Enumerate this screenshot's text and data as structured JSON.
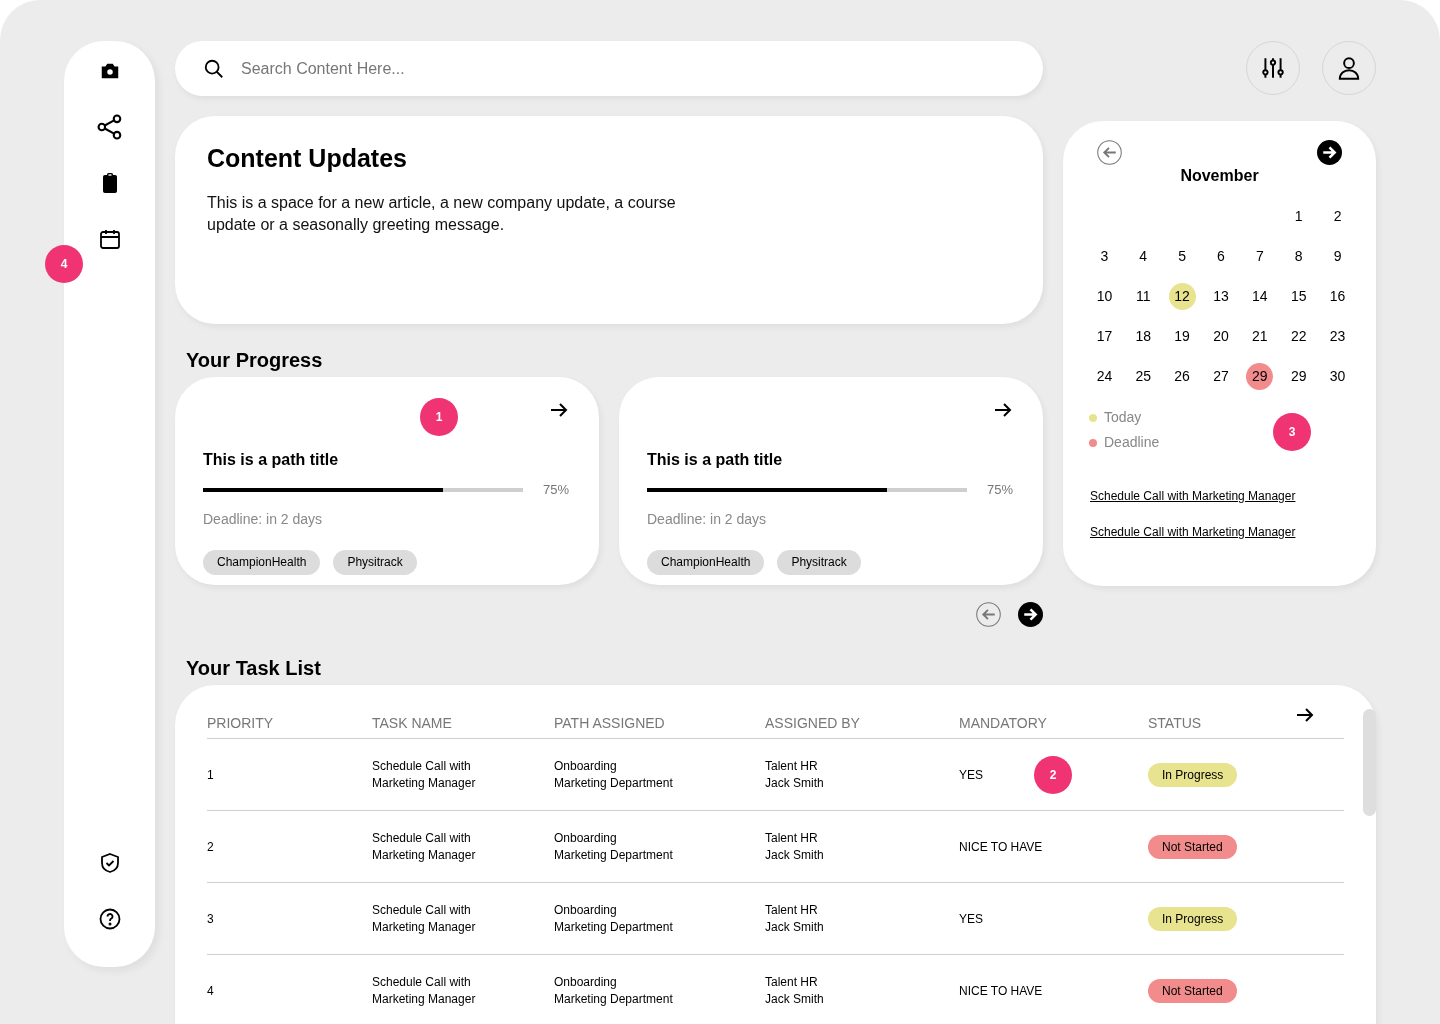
{
  "sidebar": {
    "marker": "4"
  },
  "search": {
    "placeholder": "Search Content Here..."
  },
  "content_updates": {
    "title": "Content Updates",
    "text": "This is a space for a new article, a new company update, a course update or a seasonally greeting message."
  },
  "progress": {
    "title": "Your Progress",
    "cards": [
      {
        "marker": "1",
        "title": "This is a path title",
        "level": 0.75,
        "percent": "75%",
        "deadline": "Deadline: in 2 days",
        "tags": [
          "ChampionHealth",
          "Physitrack"
        ]
      },
      {
        "title": "This is a path title",
        "level": 0.75,
        "percent": "75%",
        "deadline": "Deadline: in 2 days",
        "tags": [
          "ChampionHealth",
          "Physitrack"
        ]
      }
    ]
  },
  "calendar": {
    "month": "November",
    "marker": "3",
    "weeks": [
      [
        {
          "day": "1"
        },
        {
          "day": "2"
        }
      ],
      [
        {
          "day": "3"
        },
        {
          "day": "4"
        },
        {
          "day": "5"
        },
        {
          "day": "6"
        },
        {
          "day": "7"
        },
        {
          "day": "8"
        },
        {
          "day": "9"
        }
      ],
      [
        {
          "day": "10"
        },
        {
          "day": "11"
        },
        {
          "day": "12",
          "kind": "today"
        },
        {
          "day": "13"
        },
        {
          "day": "14"
        },
        {
          "day": "15"
        },
        {
          "day": "16"
        }
      ],
      [
        {
          "day": "17"
        },
        {
          "day": "18"
        },
        {
          "day": "19"
        },
        {
          "day": "20"
        },
        {
          "day": "21"
        },
        {
          "day": "22"
        },
        {
          "day": "23"
        }
      ],
      [
        {
          "day": "24"
        },
        {
          "day": "25"
        },
        {
          "day": "26"
        },
        {
          "day": "27"
        },
        {
          "day": "29",
          "kind": "deadline"
        },
        {
          "day": "29"
        },
        {
          "day": "30"
        }
      ]
    ],
    "legend": [
      {
        "label": "Today",
        "color": "#e8e38f"
      },
      {
        "label": "Deadline",
        "color": "#f28b8b"
      }
    ],
    "links": [
      "Schedule Call with Marketing Manager",
      "Schedule Call with Marketing Manager"
    ]
  },
  "tasks": {
    "title": "Your Task List",
    "columns": [
      "PRIORITY",
      "TASK NAME",
      "PATH ASSIGNED",
      "ASSIGNED BY",
      "MANDATORY",
      "STATUS"
    ],
    "rows": [
      {
        "priority": "1",
        "task": [
          "Schedule Call with",
          "Marketing Manager"
        ],
        "path": [
          "Onboarding",
          "Marketing Department"
        ],
        "by": [
          "Talent HR",
          "Jack Smith"
        ],
        "mandatory": "YES",
        "marker": "2",
        "status": {
          "label": "In Progress",
          "color": "#e8e38f"
        }
      },
      {
        "priority": "2",
        "task": [
          "Schedule Call with",
          "Marketing Manager"
        ],
        "path": [
          "Onboarding",
          "Marketing Department"
        ],
        "by": [
          "Talent HR",
          "Jack Smith"
        ],
        "mandatory": "NICE TO HAVE",
        "status": {
          "label": "Not Started",
          "color": "#f28b8b"
        }
      },
      {
        "priority": "3",
        "task": [
          "Schedule Call with",
          "Marketing Manager"
        ],
        "path": [
          "Onboarding",
          "Marketing Department"
        ],
        "by": [
          "Talent HR",
          "Jack Smith"
        ],
        "mandatory": "YES",
        "status": {
          "label": "In Progress",
          "color": "#e8e38f"
        }
      },
      {
        "priority": "4",
        "task": [
          "Schedule Call with",
          "Marketing Manager"
        ],
        "path": [
          "Onboarding",
          "Marketing Department"
        ],
        "by": [
          "Talent HR",
          "Jack Smith"
        ],
        "mandatory": "NICE TO HAVE",
        "status": {
          "label": "Not Started",
          "color": "#f28b8b"
        }
      }
    ]
  }
}
